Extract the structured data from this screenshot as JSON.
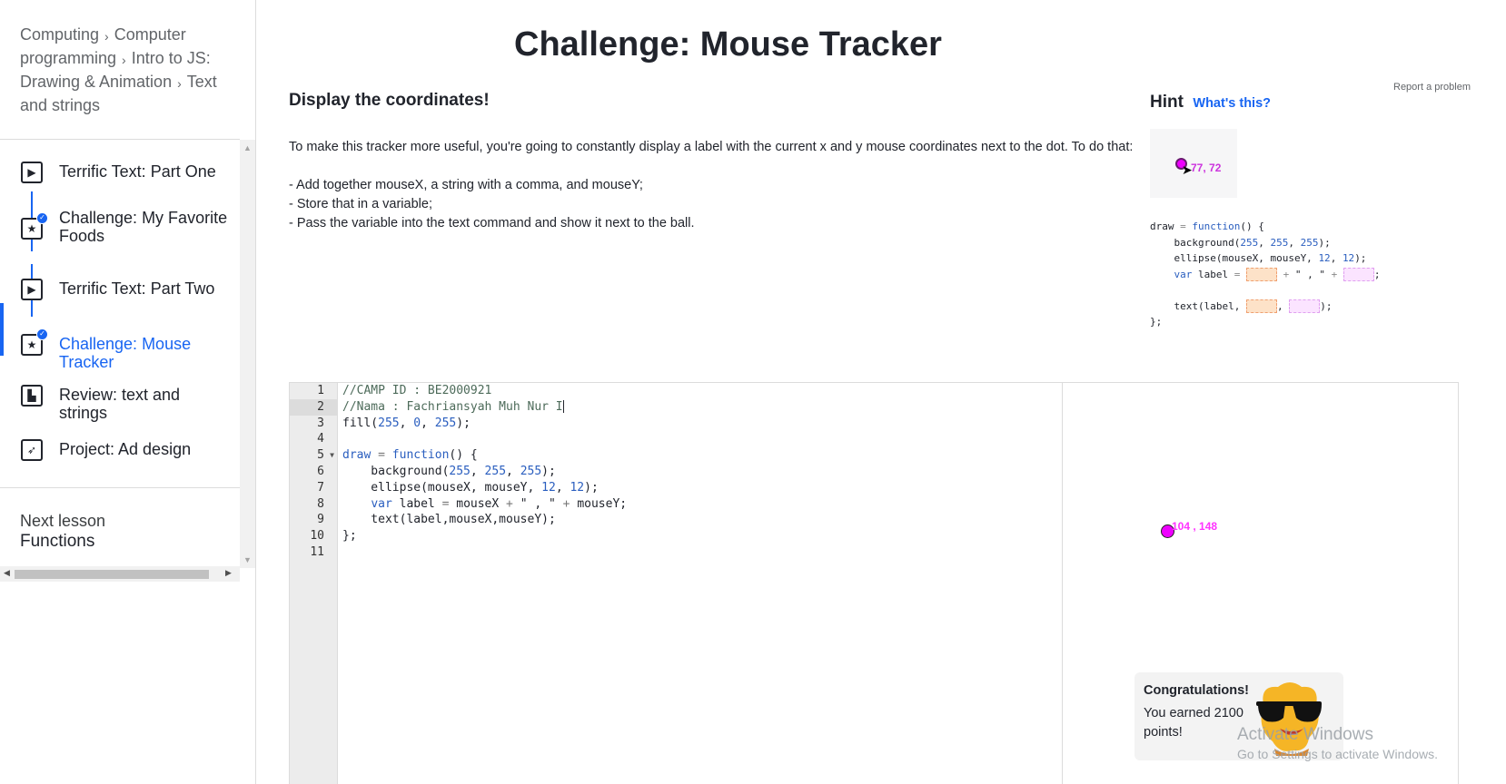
{
  "breadcrumb": {
    "items": [
      "Computing",
      "Computer programming",
      "Intro to JS: Drawing & Animation",
      "Text and strings"
    ]
  },
  "lessons": [
    {
      "label": "Terrific Text: Part One",
      "icon": "play-icon",
      "completed": false,
      "active": false
    },
    {
      "label": "Challenge: My Favorite Foods",
      "icon": "star-icon",
      "completed": true,
      "active": false
    },
    {
      "label": "Terrific Text: Part Two",
      "icon": "play-icon",
      "completed": false,
      "active": false
    },
    {
      "label": "Challenge: Mouse Tracker",
      "icon": "star-icon",
      "completed": true,
      "active": true
    },
    {
      "label": "Review: text and strings",
      "icon": "document-icon",
      "completed": false,
      "active": false
    },
    {
      "label": "Project: Ad design",
      "icon": "rocket-icon",
      "completed": false,
      "active": false
    }
  ],
  "next_lesson": {
    "key": "Next lesson",
    "value": "Functions"
  },
  "page": {
    "title": "Challenge: Mouse Tracker",
    "report_link": "Report a problem"
  },
  "instructions": {
    "heading": "Display the coordinates!",
    "intro": "To make this tracker more useful, you're going to constantly display a label with the current x and y mouse coordinates next to the dot. To do that:",
    "steps": [
      "- Add together mouseX, a string with a comma, and mouseY;",
      "- Store that in a variable;",
      "- Pass the variable into the text command and show it next to the ball."
    ]
  },
  "hint": {
    "title": "Hint",
    "link": "What's this?",
    "preview_label": "77, 72"
  },
  "editor": {
    "line_numbers": [
      "1",
      "2",
      "3",
      "4",
      "5",
      "6",
      "7",
      "8",
      "9",
      "10",
      "11"
    ],
    "highlighted_line": 2,
    "comment1": "//CAMP ID : BE2000921",
    "comment2": "//Nama : Fachriansyah Muh Nur I"
  },
  "canvas": {
    "label": "104 , 148"
  },
  "toast": {
    "title": "Congratulations!",
    "body": "You earned 2100 points!"
  },
  "watermark": {
    "line1": "Activate Windows",
    "line2": "Go to Settings to activate Windows."
  },
  "colors": {
    "accent": "#1865f2",
    "dot": "#ee00ff",
    "text": "#21242c"
  }
}
